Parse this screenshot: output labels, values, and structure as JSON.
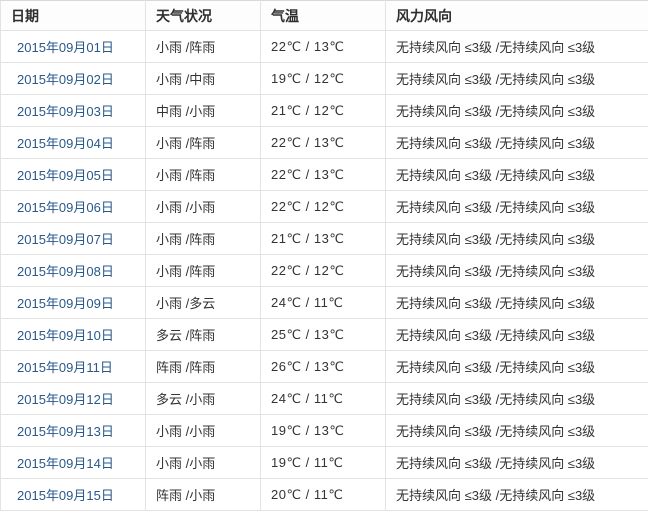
{
  "columns": [
    "日期",
    "天气状况",
    "气温",
    "风力风向"
  ],
  "rows": [
    {
      "date": "2015年09月01日",
      "weather": "小雨 /阵雨",
      "temp": "22℃ / 13℃",
      "wind": "无持续风向 ≤3级 /无持续风向 ≤3级"
    },
    {
      "date": "2015年09月02日",
      "weather": "小雨 /中雨",
      "temp": "19℃ / 12℃",
      "wind": "无持续风向 ≤3级 /无持续风向 ≤3级"
    },
    {
      "date": "2015年09月03日",
      "weather": "中雨 /小雨",
      "temp": "21℃ / 12℃",
      "wind": "无持续风向 ≤3级 /无持续风向 ≤3级"
    },
    {
      "date": "2015年09月04日",
      "weather": "小雨 /阵雨",
      "temp": "22℃ / 13℃",
      "wind": "无持续风向 ≤3级 /无持续风向 ≤3级"
    },
    {
      "date": "2015年09月05日",
      "weather": "小雨 /阵雨",
      "temp": "22℃ / 13℃",
      "wind": "无持续风向 ≤3级 /无持续风向 ≤3级"
    },
    {
      "date": "2015年09月06日",
      "weather": "小雨 /小雨",
      "temp": "22℃ / 12℃",
      "wind": "无持续风向 ≤3级 /无持续风向 ≤3级"
    },
    {
      "date": "2015年09月07日",
      "weather": "小雨 /阵雨",
      "temp": "21℃ / 13℃",
      "wind": "无持续风向 ≤3级 /无持续风向 ≤3级"
    },
    {
      "date": "2015年09月08日",
      "weather": "小雨 /阵雨",
      "temp": "22℃ / 12℃",
      "wind": "无持续风向 ≤3级 /无持续风向 ≤3级"
    },
    {
      "date": "2015年09月09日",
      "weather": "小雨 /多云",
      "temp": "24℃ / 11℃",
      "wind": "无持续风向 ≤3级 /无持续风向 ≤3级"
    },
    {
      "date": "2015年09月10日",
      "weather": "多云 /阵雨",
      "temp": "25℃ / 13℃",
      "wind": "无持续风向 ≤3级 /无持续风向 ≤3级"
    },
    {
      "date": "2015年09月11日",
      "weather": "阵雨 /阵雨",
      "temp": "26℃ / 13℃",
      "wind": "无持续风向 ≤3级 /无持续风向 ≤3级"
    },
    {
      "date": "2015年09月12日",
      "weather": "多云 /小雨",
      "temp": "24℃ / 11℃",
      "wind": "无持续风向 ≤3级 /无持续风向 ≤3级"
    },
    {
      "date": "2015年09月13日",
      "weather": "小雨 /小雨",
      "temp": "19℃ / 13℃",
      "wind": "无持续风向 ≤3级 /无持续风向 ≤3级"
    },
    {
      "date": "2015年09月14日",
      "weather": "小雨 /小雨",
      "temp": "19℃ / 11℃",
      "wind": "无持续风向 ≤3级 /无持续风向 ≤3级"
    },
    {
      "date": "2015年09月15日",
      "weather": "阵雨 /小雨",
      "temp": "20℃ / 11℃",
      "wind": "无持续风向 ≤3级 /无持续风向 ≤3级"
    }
  ],
  "colors": {
    "date_link": "#28588c",
    "header_text": "#2f2f2f",
    "body_text": "#333333",
    "border": "#e3e3e3"
  }
}
